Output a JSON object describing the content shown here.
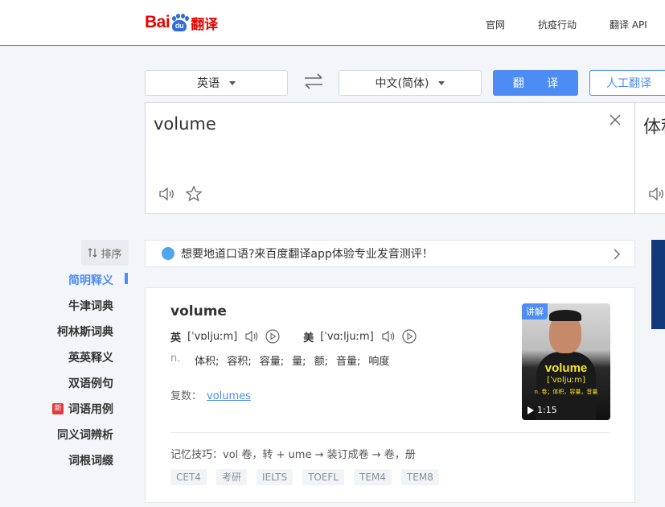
{
  "header": {
    "logo_bai": "Bai",
    "logo_du": "du",
    "logo_fanyi": "翻译",
    "nav": [
      "官网",
      "抗疫行动",
      "翻译 API"
    ]
  },
  "langbar": {
    "source": "英语",
    "target": "中文(简体)",
    "translate_label": "翻 译",
    "human_label": "人工翻译"
  },
  "input": {
    "text": "volume"
  },
  "output": {
    "text": "体积"
  },
  "sidebar": {
    "sort_label": "排序",
    "items": [
      {
        "label": "简明释义"
      },
      {
        "label": "牛津词典"
      },
      {
        "label": "柯林斯词典"
      },
      {
        "label": "英英释义"
      },
      {
        "label": "双语例句"
      },
      {
        "label": "词语用例",
        "badge": "新"
      },
      {
        "label": "同义词辨析"
      },
      {
        "label": "词根词缀"
      }
    ]
  },
  "notice": {
    "text": "想要地道口语?来百度翻译app体验专业发音测评！"
  },
  "dict": {
    "word": "volume",
    "uk_label": "英",
    "uk_ipa": "[ˈvɒljuːm]",
    "us_label": "美",
    "us_ipa": "[ˈvɑːljuːm]",
    "pos": "n.",
    "meanings": [
      "体积;",
      "容积;",
      "容量;",
      "量;",
      "额;",
      "音量;",
      "响度"
    ],
    "plural_label": "复数：",
    "plural_value": "volumes",
    "memo": "记忆技巧：vol 卷，转 + ume → 装订成卷 → 卷，册",
    "tags": [
      "CET4",
      "考研",
      "IELTS",
      "TOEFL",
      "TEM4",
      "TEM8"
    ]
  },
  "video": {
    "badge": "讲解",
    "word": "volume",
    "ipa": "[ˈvɒljuːm]",
    "def": "n. 卷；体积，容量，音量",
    "duration": "1:15"
  }
}
